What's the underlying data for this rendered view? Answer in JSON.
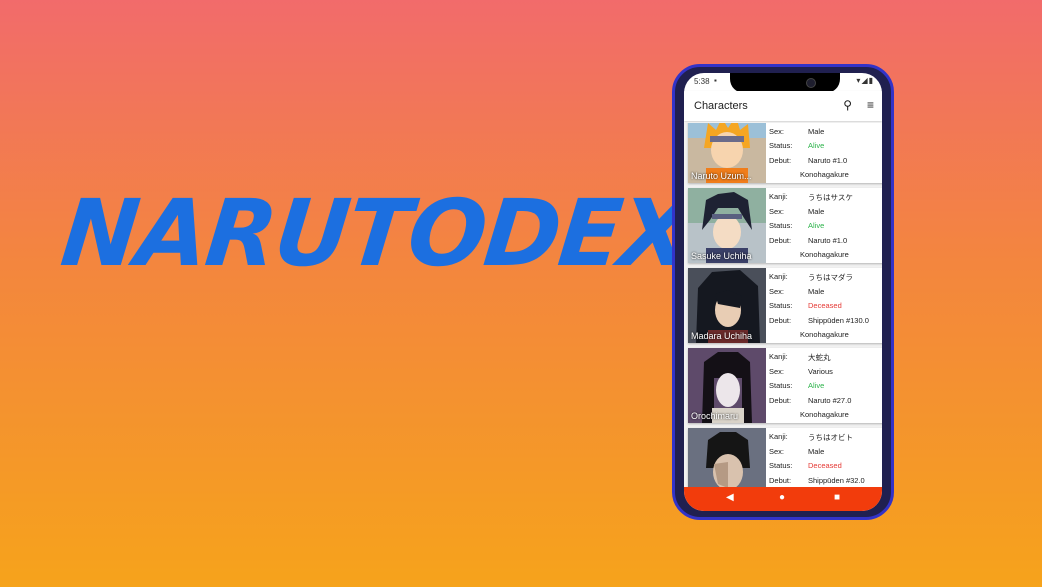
{
  "logo": "NARUTODEX",
  "status": {
    "time": "5:38",
    "sim": "▪",
    "icons": "▾◢▮"
  },
  "appbar": {
    "title": "Characters"
  },
  "labels": {
    "kanji": "Kanji:",
    "sex": "Sex:",
    "status": "Status:",
    "debut": "Debut:"
  },
  "characters": [
    {
      "name": "Naruto Uzum...",
      "kanji": "",
      "sex": "Male",
      "status": "Alive",
      "debut": "Naruto #1.0",
      "village": "Konohagakure"
    },
    {
      "name": "Sasuke Uchiha",
      "kanji": "うちはサスケ",
      "sex": "Male",
      "status": "Alive",
      "debut": "Naruto #1.0",
      "village": "Konohagakure"
    },
    {
      "name": "Madara Uchiha",
      "kanji": "うちはマダラ",
      "sex": "Male",
      "status": "Deceased",
      "debut": "Shippūden #130.0",
      "village": "Konohagakure"
    },
    {
      "name": "Orochimaru",
      "kanji": "大蛇丸",
      "sex": "Various",
      "status": "Alive",
      "debut": "Naruto #27.0",
      "village": "Konohagakure"
    },
    {
      "name": "",
      "kanji": "うちはオビト",
      "sex": "Male",
      "status": "Deceased",
      "debut": "Shippūden #32.0",
      "village": ""
    }
  ],
  "colors": {
    "accent": "#1c6fe0",
    "navbar": "#f23c0c",
    "alive": "#2bb34a",
    "dead": "#e53935"
  }
}
